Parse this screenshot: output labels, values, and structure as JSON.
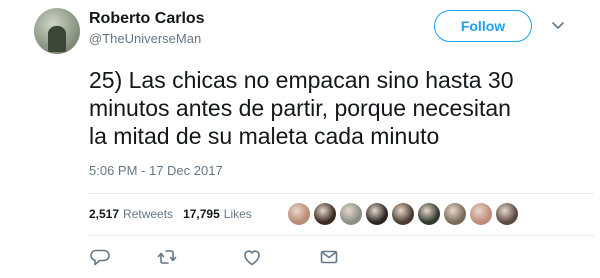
{
  "user": {
    "display_name": "Roberto Carlos",
    "username": "@TheUniverseMan"
  },
  "header": {
    "follow_label": "Follow",
    "caret_icon": "chevron-down-icon"
  },
  "tweet": {
    "text": "25) Las chicas no empacan sino hasta 30\nminutos antes de partir, porque necesitan\nla mitad de su maleta cada minuto",
    "timestamp": "5:06 PM - 17 Dec 2017"
  },
  "stats": {
    "retweets_count": "2,517",
    "retweets_label": "Retweets",
    "likes_count": "17,795",
    "likes_label": "Likes"
  },
  "liker_avatars": [
    {
      "color": "#b98a74"
    },
    {
      "color": "#3a2a22"
    },
    {
      "color": "#8a8f86"
    },
    {
      "color": "#2b2520"
    },
    {
      "color": "#4a3b31"
    },
    {
      "color": "#2f3a2c"
    },
    {
      "color": "#7a6a5c"
    },
    {
      "color": "#c08c7a"
    },
    {
      "color": "#5a4a44"
    }
  ],
  "actions": {
    "reply_icon": "reply-icon",
    "retweet_icon": "retweet-icon",
    "like_icon": "heart-icon",
    "message_icon": "envelope-icon"
  },
  "colors": {
    "accent": "#1da1f2",
    "text_primary": "#14171a",
    "text_secondary": "#657786",
    "divider": "#e6ecf0"
  }
}
